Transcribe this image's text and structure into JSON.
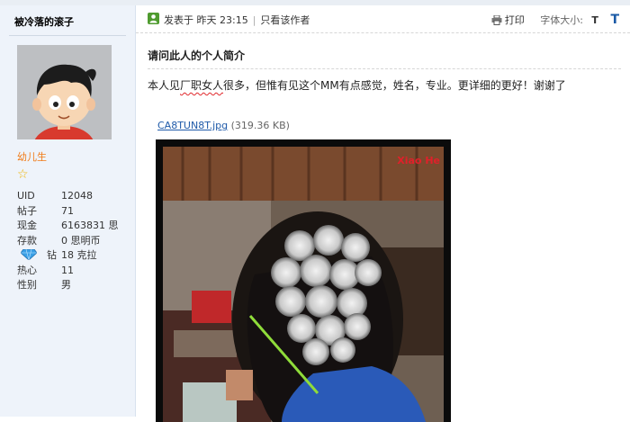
{
  "sidebar": {
    "username": "被冷落的滚子",
    "rank": "幼儿生",
    "stats": [
      {
        "label": "UID",
        "value": "12048"
      },
      {
        "label": "帖子",
        "value": "71"
      },
      {
        "label": "现金",
        "value": "6163831 思"
      },
      {
        "label": "存款",
        "value": "0 思明币"
      },
      {
        "label": "钻",
        "value": "18 克拉"
      },
      {
        "label": "热心",
        "value": "11"
      },
      {
        "label": "性别",
        "value": "男"
      }
    ]
  },
  "post": {
    "posted_label": "发表于",
    "time": "昨天 23:15",
    "only_author": "只看该作者",
    "print_label": "打印",
    "font_size_label": "字体大小:",
    "font_small": "T",
    "font_large": "T",
    "title": "请问此人的个人简介",
    "body_pre": "本人见",
    "body_mark": "厂职女人",
    "body_post": "很多，但惟有见这个MM有点感觉，姓名，专业。更详细的更好！谢谢了",
    "attachment_name": "CA8TUN8T.jpg",
    "attachment_size": "(319.36 KB)",
    "watermark": "Xiao He"
  },
  "colors": {
    "sidebar_bg": "#eef3fa",
    "link": "#1f5aa9",
    "rank": "#f07a16",
    "online": "#4f9b2f",
    "watermark": "#e0202a"
  }
}
